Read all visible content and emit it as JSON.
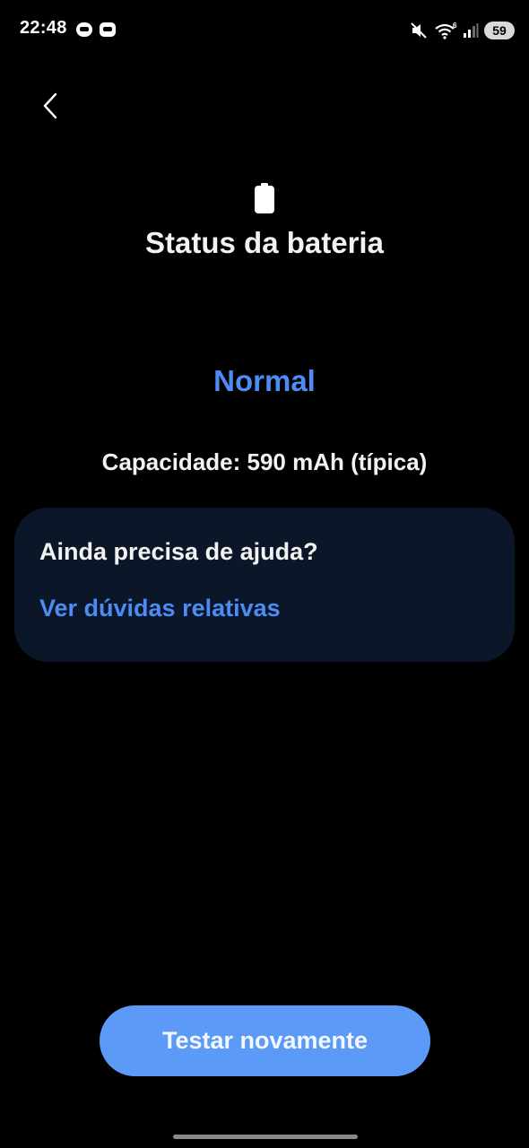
{
  "status_bar": {
    "time": "22:48",
    "battery_level": "59",
    "icons": [
      "notification-app-icon",
      "notification-card-icon",
      "mute-icon",
      "wifi-6-icon",
      "signal-icon",
      "battery-icon"
    ]
  },
  "header": {
    "back_icon": "chevron-left-icon",
    "hero_icon": "battery-icon",
    "title": "Status da bateria"
  },
  "battery_status": {
    "status": "Normal",
    "capacity": "Capacidade: 590 mAh (típica)"
  },
  "help_card": {
    "title": "Ainda precisa de ajuda?",
    "link": "Ver dúvidas relativas"
  },
  "actions": {
    "retest_label": "Testar novamente"
  },
  "colors": {
    "background": "#000000",
    "accent": "#4d8bf5",
    "button": "#5b9af6",
    "card": "#0b1628"
  }
}
